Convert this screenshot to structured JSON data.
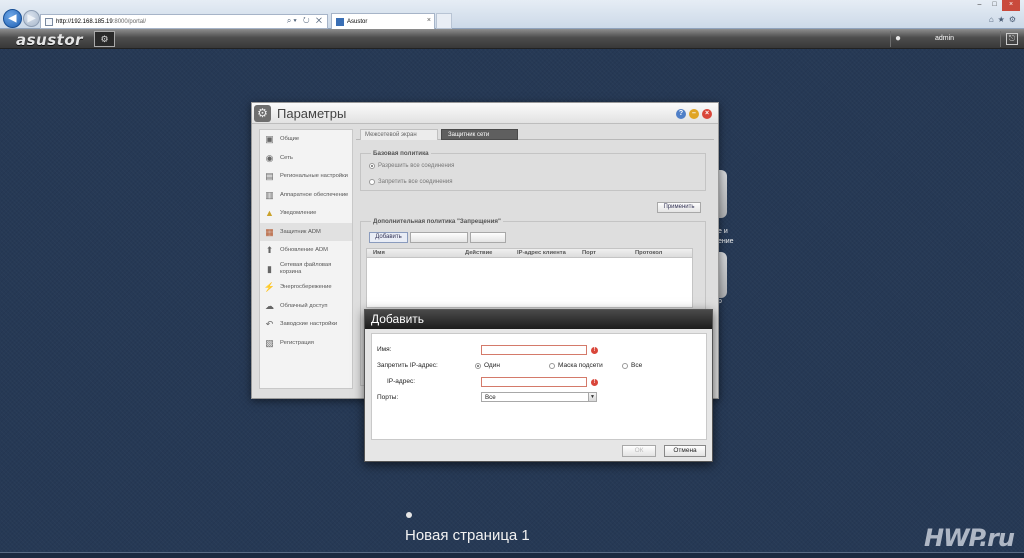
{
  "browser": {
    "url_host": "http://192.168.185.19",
    "url_path": ":8000/portal/",
    "tab_title": "Asustor"
  },
  "adm": {
    "logo_text": "asustor",
    "user_name": "admin"
  },
  "settings": {
    "title": "Параметры",
    "sidebar": [
      {
        "label": "Общие",
        "icon": "general-icon"
      },
      {
        "label": "Сеть",
        "icon": "network-icon"
      },
      {
        "label": "Региональные настройки",
        "icon": "regional-icon"
      },
      {
        "label": "Аппаратное обеспечение",
        "icon": "hardware-icon"
      },
      {
        "label": "Уведомление",
        "icon": "notification-icon"
      },
      {
        "label": "Защитник ADM",
        "icon": "defender-icon"
      },
      {
        "label": "Обновление ADM",
        "icon": "update-icon"
      },
      {
        "label": "Сетевая файловая корзина",
        "icon": "recycle-bin-icon"
      },
      {
        "label": "Энергосбережение",
        "icon": "energy-icon"
      },
      {
        "label": "Облачный доступ",
        "icon": "cloud-icon"
      },
      {
        "label": "Заводские настройки",
        "icon": "reset-icon"
      },
      {
        "label": "Регистрация",
        "icon": "registration-icon"
      }
    ],
    "tabs": [
      "Межсетевой экран",
      "Защитник сети"
    ],
    "basic_policy": {
      "label": "Базовая политика",
      "allow_all": "Разрешить все соединения",
      "deny_all": "Запретить все соединения"
    },
    "apply_label": "Применить",
    "extra_policy": {
      "label": "Дополнительная политика \"Запрещения\"",
      "add_label": "Добавить",
      "columns": [
        "Имя",
        "Действие",
        "IP-адрес клиента",
        "Порт",
        "Протокол"
      ]
    }
  },
  "dialog": {
    "title": "Добавить",
    "name_label": "Имя:",
    "deny_ip_label": "Запретить IP-адрес:",
    "ip_options": [
      "Один",
      "Маска подсети",
      "Все"
    ],
    "ip_label": "IP-адрес:",
    "ports_label": "Порты:",
    "ports_value": "Все",
    "ok_label": "ОК",
    "cancel_label": "Отмена"
  },
  "desktop": {
    "page_name": "Новая страница 1",
    "label_fragments": [
      "е и",
      "ение",
      "р"
    ]
  },
  "watermark": "HWP.ru",
  "colors": {
    "desktop_bg": "#263955",
    "active_tab": "#5f5f5f",
    "error": "#d9463a",
    "dialog_title": "#1c1c1c"
  }
}
